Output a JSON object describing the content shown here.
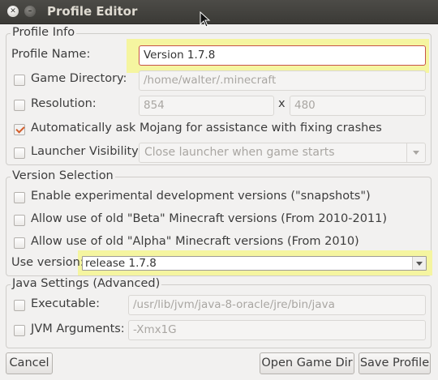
{
  "window": {
    "title": "Profile Editor"
  },
  "profile_info": {
    "legend": "Profile Info",
    "profile_name": {
      "label": "Profile Name:",
      "value": "Version 1.7.8"
    },
    "game_directory": {
      "label": "Game Directory:",
      "value": "/home/walter/.minecraft",
      "checked": false
    },
    "resolution": {
      "label": "Resolution:",
      "width": "854",
      "separator": "x",
      "height": "480",
      "checked": false
    },
    "mojang_assist": {
      "label": "Automatically ask Mojang for assistance with fixing crashes",
      "checked": true
    },
    "launcher_visibility": {
      "label": "Launcher Visibility:",
      "value": "Close launcher when game starts",
      "checked": false
    }
  },
  "version_selection": {
    "legend": "Version Selection",
    "snapshots": {
      "label": "Enable experimental development versions (\"snapshots\")",
      "checked": false
    },
    "beta": {
      "label": "Allow use of old \"Beta\" Minecraft versions (From 2010-2011)",
      "checked": false
    },
    "alpha": {
      "label": "Allow use of old \"Alpha\" Minecraft versions (From 2010)",
      "checked": false
    },
    "use_version": {
      "label": "Use version:",
      "value": "release 1.7.8"
    }
  },
  "java_settings": {
    "legend": "Java Settings (Advanced)",
    "executable": {
      "label": "Executable:",
      "value": "/usr/lib/jvm/java-8-oracle/jre/bin/java",
      "checked": false
    },
    "jvm_arguments": {
      "label": "JVM Arguments:",
      "value": "-Xmx1G",
      "checked": false
    }
  },
  "buttons": {
    "cancel": "Cancel",
    "open_game_dir": "Open Game Dir",
    "save_profile": "Save Profile"
  },
  "colors": {
    "highlight": "#f5f5a0",
    "accent": "#d35d2a",
    "titlebar": "#3b3a36"
  }
}
